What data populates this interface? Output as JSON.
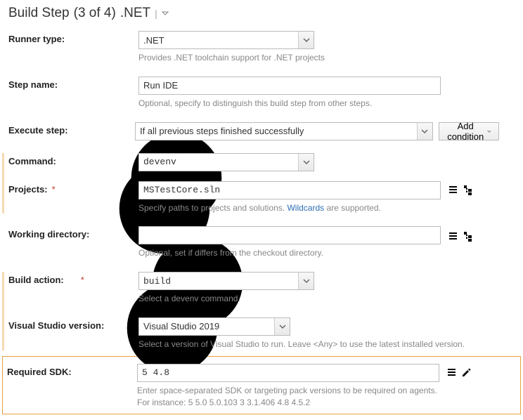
{
  "title": {
    "prefix": "Build Step",
    "count": "(3 of 4)",
    "name": ".NET"
  },
  "runnerType": {
    "label": "Runner type:",
    "value": ".NET",
    "hint": "Provides .NET toolchain support for .NET projects"
  },
  "stepName": {
    "label": "Step name:",
    "value": "Run IDE",
    "hint": "Optional, specify to distinguish this build step from other steps."
  },
  "executeStep": {
    "label": "Execute step:",
    "value": "If all previous steps finished successfully",
    "button": "Add condition"
  },
  "command": {
    "label": "Command:",
    "value": "devenv"
  },
  "projects": {
    "label": "Projects:",
    "value": "MSTestCore.sln",
    "hint_before": "Specify paths to projects and solutions. ",
    "hint_link": "Wildcards",
    "hint_after": " are supported."
  },
  "workingDir": {
    "label": "Working directory:",
    "value": "",
    "hint": "Optional, set if differs from the checkout directory."
  },
  "buildAction": {
    "label": "Build action:",
    "value": "build",
    "hint": "Select a devenv command."
  },
  "vsVersion": {
    "label": "Visual Studio version:",
    "value": "Visual Studio 2019",
    "hint": "Select a version of Visual Studio to run. Leave <Any> to use the latest installed version."
  },
  "requiredSdk": {
    "label": "Required SDK:",
    "value": "5 4.8",
    "hint1": "Enter space-separated SDK or targeting pack versions to be required on agents.",
    "hint2": "For instance: 5 5.0 5.0.103 3 3.1.406 4.8 4.5.2"
  }
}
